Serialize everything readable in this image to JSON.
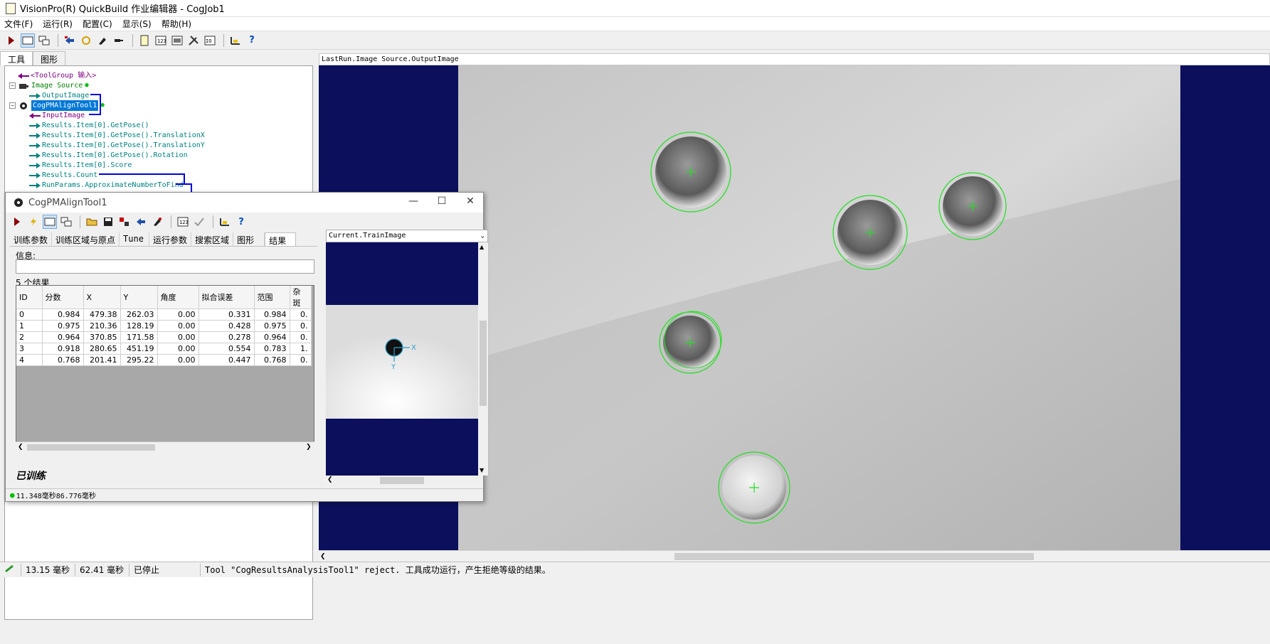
{
  "window": {
    "title": "VisionPro(R) QuickBuild 作业编辑器 - CogJob1"
  },
  "menu": [
    "文件(F)",
    "运行(R)",
    "配置(C)",
    "显示(S)",
    "帮助(H)"
  ],
  "left_tabs": [
    "工具",
    "图形"
  ],
  "tree": {
    "toolgroup_input": "<ToolGroup 输入>",
    "image_source": "Image Source",
    "output_image": "OutputImage",
    "pm_tool": "CogPMAlignTool1",
    "input_image": "InputImage",
    "outputs": [
      "Results.Item[0].GetPose()",
      "Results.Item[0].GetPose().TranslationX",
      "Results.Item[0].GetPose().TranslationY",
      "Results.Item[0].GetPose().Rotation",
      "Results.Item[0].Score",
      "Results.Count",
      "RunParams.ApproximateNumberToFind"
    ]
  },
  "image_panel": {
    "header": "LastRun.Image Source.OutputImage"
  },
  "status_bar": {
    "time1": "13.15 毫秒",
    "time2": "62.41 毫秒",
    "state": "已停止",
    "message": "Tool \"CogResultsAnalysisTool1\" reject. 工具成功运行，产生拒绝等级的结果。"
  },
  "dialog": {
    "title": "CogPMAlignTool1",
    "tabs": [
      "训练参数",
      "训练区域与原点",
      "Tune",
      "运行参数",
      "搜索区域",
      "图形",
      "结果"
    ],
    "info_label": "信息:",
    "result_count": "5 个结果",
    "columns": [
      "ID",
      "分数",
      "X",
      "Y",
      "角度",
      "拟合误差",
      "范围",
      "杂斑"
    ],
    "rows": [
      [
        "0",
        "0.984",
        "479.38",
        "262.03",
        "0.00",
        "0.331",
        "0.984",
        "0."
      ],
      [
        "1",
        "0.975",
        "210.36",
        "128.19",
        "0.00",
        "0.428",
        "0.975",
        "0."
      ],
      [
        "2",
        "0.964",
        "370.85",
        "171.58",
        "0.00",
        "0.278",
        "0.964",
        "0."
      ],
      [
        "3",
        "0.918",
        "280.65",
        "451.19",
        "0.00",
        "0.554",
        "0.783",
        "1."
      ],
      [
        "4",
        "0.768",
        "201.41",
        "295.22",
        "0.00",
        "0.447",
        "0.768",
        "0."
      ]
    ],
    "train_header": "Current.TrainImage",
    "trained_label": "已训练",
    "timing": "11.348毫秒86.776毫秒",
    "x_axis": "X",
    "y_axis": "Y"
  }
}
